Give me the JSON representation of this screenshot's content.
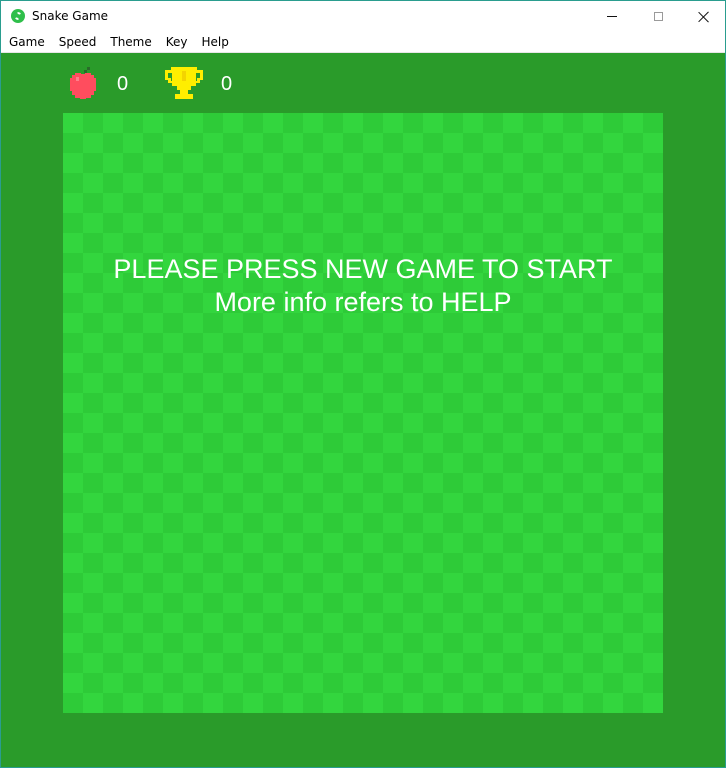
{
  "window": {
    "title": "Snake Game",
    "icon": "snake-app-icon"
  },
  "menu": [
    "Game",
    "Speed",
    "Theme",
    "Key",
    "Help"
  ],
  "scoreboard": {
    "apples": "0",
    "apple_icon": "apple-icon",
    "best": "0",
    "best_icon": "trophy-icon"
  },
  "board": {
    "message_line1": "PLEASE PRESS NEW GAME TO START",
    "message_line2": "More info refers to HELP"
  },
  "colors": {
    "frame": "#2a9b2a",
    "board_light": "#33d63e",
    "board_dark": "#2ecb38",
    "apple": "#ff4d5e",
    "trophy": "#ffee00",
    "text": "#ffffff"
  }
}
